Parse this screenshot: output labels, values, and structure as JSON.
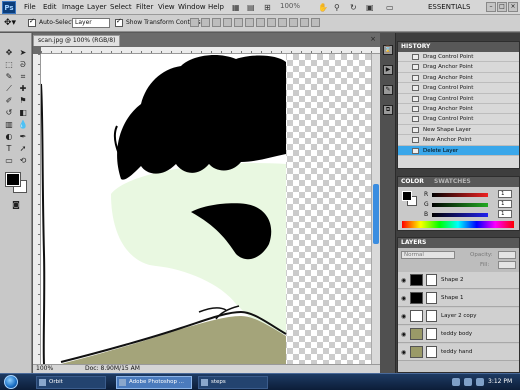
{
  "menu": {
    "logo": "Ps",
    "items": [
      "File",
      "Edit",
      "Image",
      "Layer",
      "Select",
      "Filter",
      "View",
      "Window",
      "Help"
    ],
    "zoom": "100%",
    "workspace": "ESSENTIALS"
  },
  "options": {
    "auto_select_label": "Auto-Select:",
    "auto_select_value": "Layer",
    "show_transform_label": "Show Transform Controls"
  },
  "document": {
    "tab_title": "scan.jpg @ 100% (RGB/8)",
    "zoom": "100%",
    "doc_size": "Doc: 8.90M/15 AM"
  },
  "history": {
    "title": "HISTORY",
    "items": [
      "Drag Control Point",
      "Drag Anchor Point",
      "Drag Anchor Point",
      "Drag Control Point",
      "Drag Control Point",
      "Drag Anchor Point",
      "Drag Control Point",
      "New Shape Layer",
      "New Anchor Point",
      "Delete Layer"
    ],
    "selected_index": 9
  },
  "color": {
    "tabs": [
      "COLOR",
      "SWATCHES"
    ],
    "channels": [
      {
        "name": "R",
        "value": "1",
        "color": "#e22"
      },
      {
        "name": "G",
        "value": "1",
        "color": "#2a2"
      },
      {
        "name": "B",
        "value": "1",
        "color": "#22e"
      }
    ]
  },
  "layers": {
    "title": "LAYERS",
    "blend": "Normal",
    "opacity_label": "Opacity:",
    "fill_label": "Fill:",
    "items": [
      {
        "name": "Shape 2",
        "thumb": "#000000"
      },
      {
        "name": "Shape 1",
        "thumb": "#000000"
      },
      {
        "name": "Layer 2 copy",
        "thumb": "#ffffff"
      },
      {
        "name": "teddy body",
        "thumb": "#9a9a68"
      },
      {
        "name": "teddy hand",
        "thumb": "#9a9a68"
      }
    ]
  },
  "taskbar": {
    "buttons": [
      "Orbit",
      "Adobe Photoshop ...",
      "steps"
    ],
    "time": "3:12 PM"
  },
  "colors": {
    "accent": "#3aa7ea",
    "skin": "#e9f8e1",
    "body": "#a4a47a"
  }
}
